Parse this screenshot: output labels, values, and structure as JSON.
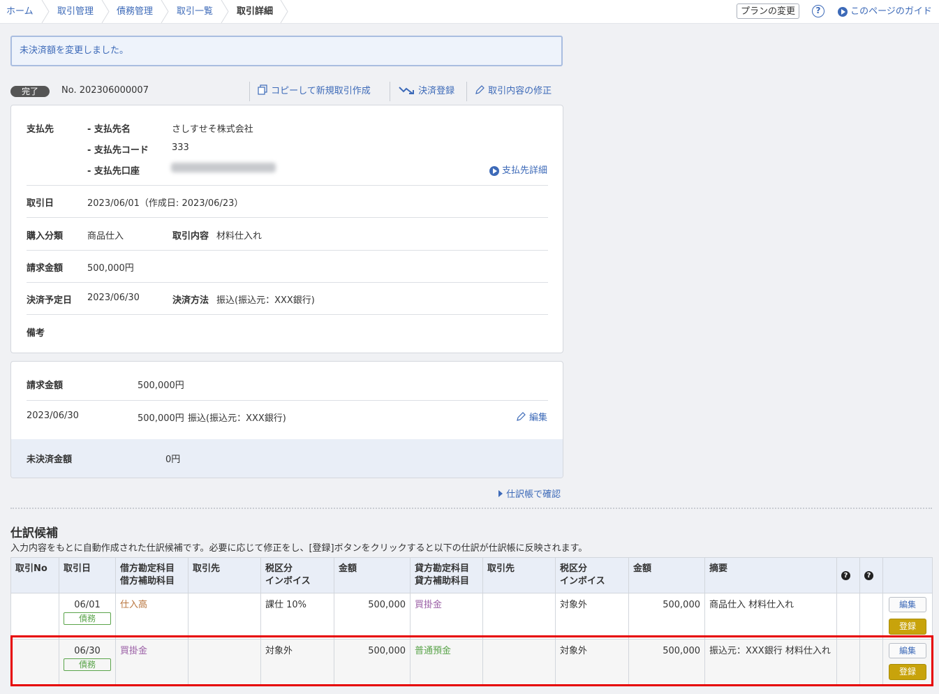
{
  "breadcrumb": [
    "ホーム",
    "取引管理",
    "債務管理",
    "取引一覧",
    "取引詳細"
  ],
  "header": {
    "plan_button": "プランの変更",
    "help_icon": "?",
    "guide_link": "このページのガイド"
  },
  "notice": "未決済額を変更しました。",
  "transaction": {
    "status": "完了",
    "number": "No. 202306000007",
    "actions": {
      "copy": "コピーして新規取引作成",
      "settle": "決済登録",
      "edit": "取引内容の修正"
    }
  },
  "detail": {
    "payee_label": "支払先",
    "payee_name_label": "- 支払先名",
    "payee_name": "さしすせそ株式会社",
    "payee_code_label": "- 支払先コード",
    "payee_code": "333",
    "payee_account_label": "- 支払先口座",
    "payee_detail_link": "支払先詳細",
    "date_label": "取引日",
    "date_value": "2023/06/01（作成日: 2023/06/23）",
    "purchase_type_label": "購入分類",
    "purchase_type": "商品仕入",
    "content_label": "取引内容",
    "content": "材料仕入れ",
    "billed_label": "請求金額",
    "billed": "500,000円",
    "due_label": "決済予定日",
    "due": "2023/06/30",
    "method_label": "決済方法",
    "method": "振込(振込元：XXX銀行)",
    "memo_label": "備考"
  },
  "settlement": {
    "billed_label": "請求金額",
    "billed": "500,000円",
    "row_date": "2023/06/30",
    "row_amount": "500,000円",
    "row_method": "振込(振込元：XXX銀行)",
    "edit_link": "編集",
    "unsettled_label": "未決済金額",
    "unsettled": "0円"
  },
  "ledger_link": "仕訳帳で確認",
  "journal": {
    "title": "仕訳候補",
    "description": "入力内容をもとに自動作成された仕訳候補です。必要に応じて修正をし、[登録]ボタンをクリックすると以下の仕訳が仕訳帳に反映されます。",
    "columns": {
      "no": "取引No",
      "date": "取引日",
      "debit_account": "借方勘定科目",
      "debit_sub": "借方補助科目",
      "partner1": "取引先",
      "tax1": "税区分",
      "invoice1": "インボイス",
      "amount1": "金額",
      "credit_account": "貸方勘定科目",
      "credit_sub": "貸方補助科目",
      "partner2": "取引先",
      "tax2": "税区分",
      "invoice2": "インボイス",
      "amount2": "金額",
      "memo": "摘要",
      "q1": "?",
      "q2": "?"
    },
    "rows": [
      {
        "no": "",
        "date": "06/01",
        "tag": "債務",
        "debit": "仕入高",
        "partner1": "",
        "tax1": "課仕 10%",
        "amount1": "500,000",
        "credit": "買掛金",
        "partner2": "",
        "tax2": "対象外",
        "amount2": "500,000",
        "memo": "商品仕入 材料仕入れ",
        "edit": "編集",
        "register": "登録"
      },
      {
        "no": "",
        "date": "06/30",
        "tag": "債務",
        "debit": "買掛金",
        "partner1": "",
        "tax1": "対象外",
        "amount1": "500,000",
        "credit": "普通預金",
        "partner2": "",
        "tax2": "対象外",
        "amount2": "500,000",
        "memo": "振込元：XXX銀行 材料仕入れ",
        "edit": "編集",
        "register": "登録"
      }
    ]
  }
}
